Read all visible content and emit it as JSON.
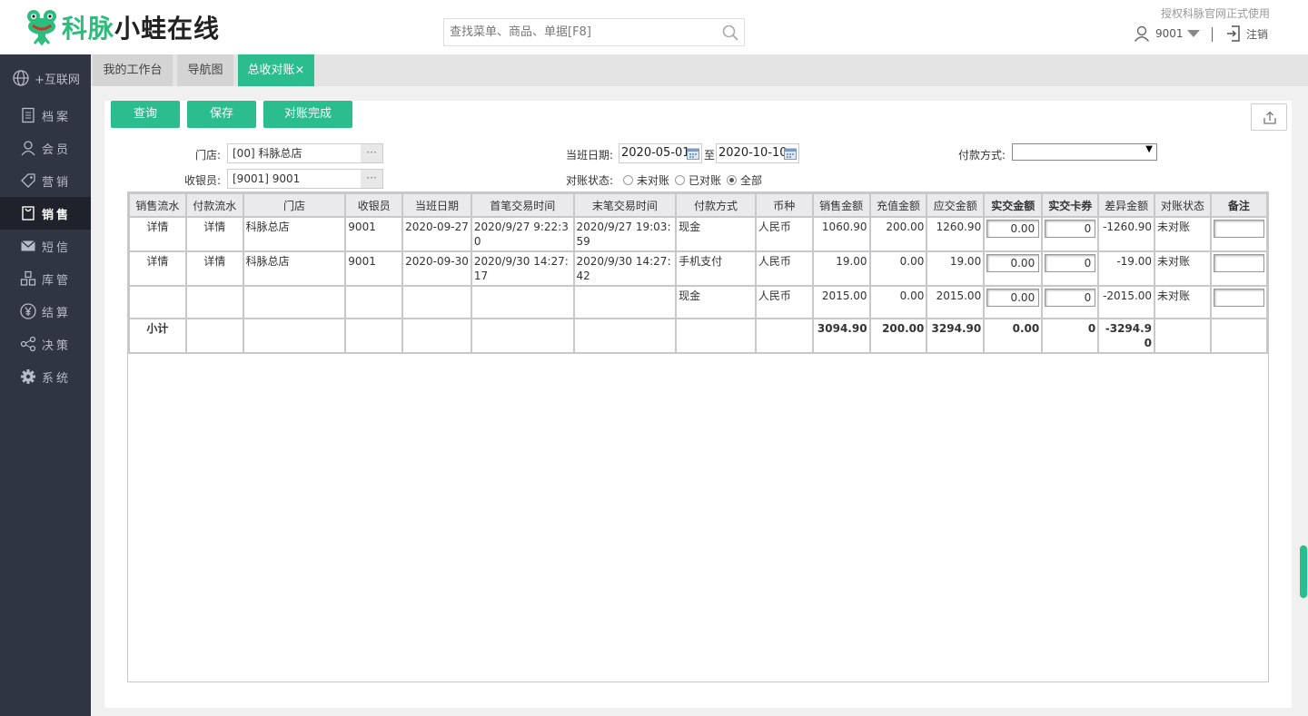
{
  "brand": {
    "part1": "科脉",
    "part2": "小蛙在线",
    "green": "#2bbd7e"
  },
  "search": {
    "placeholder": "查找菜单、商品、单据[F8]"
  },
  "header": {
    "auth_text": "授权科脉官网正式使用",
    "user": "9001",
    "logout": "注销"
  },
  "sidebar": {
    "items": [
      {
        "label": "+互联网",
        "icon": "globe-icon"
      },
      {
        "label": "档案",
        "icon": "document-icon"
      },
      {
        "label": "会员",
        "icon": "user-icon"
      },
      {
        "label": "营销",
        "icon": "tag-icon"
      },
      {
        "label": "销售",
        "icon": "bag-icon",
        "active": true
      },
      {
        "label": "短信",
        "icon": "mail-icon"
      },
      {
        "label": "库管",
        "icon": "boxes-icon"
      },
      {
        "label": "结算",
        "icon": "yen-icon"
      },
      {
        "label": "决策",
        "icon": "share-icon"
      },
      {
        "label": "系统",
        "icon": "gear-icon"
      }
    ]
  },
  "tabs": [
    {
      "label": "我的工作台"
    },
    {
      "label": "导航图"
    },
    {
      "label": "总收对账",
      "close": "×",
      "active": true
    }
  ],
  "toolbar": {
    "query": "查询",
    "save": "保存",
    "complete": "对账完成"
  },
  "form": {
    "store_label": "门店:",
    "store_value": "[00] 科脉总店",
    "cashier_label": "收银员:",
    "cashier_value": "[9001] 9001",
    "ellipsis": "···",
    "shift_date_label": "当班日期:",
    "date_from": "2020-05-01",
    "date_to_sep": "至",
    "date_to": "2020-10-10",
    "pay_method_label": "付款方式:",
    "pay_method_value": "",
    "status_label": "对账状态:",
    "status_options": [
      "未对账",
      "已对账",
      "全部"
    ],
    "status_selected": "全部"
  },
  "table": {
    "headers": [
      "销售流水",
      "付款流水",
      "门店",
      "收银员",
      "当班日期",
      "首笔交易时间",
      "末笔交易时间",
      "付款方式",
      "币种",
      "销售金额",
      "充值金额",
      "应交金额",
      "实交金额",
      "实交卡券",
      "差异金额",
      "对账状态",
      "备注"
    ],
    "rows": [
      {
        "sale_flow": "详情",
        "pay_flow": "详情",
        "store": "科脉总店",
        "cashier": "9001",
        "date": "2020-09-27",
        "first_time": "2020/9/27 9:22:30",
        "last_time": "2020/9/27 19:03:59",
        "pay_method": "现金",
        "currency": "人民币",
        "sales": "1060.90",
        "recharge": "200.00",
        "due": "1260.90",
        "paid": "0.00",
        "coupon": "0",
        "diff": "-1260.90",
        "status": "未对账",
        "remark": ""
      },
      {
        "sale_flow": "详情",
        "pay_flow": "详情",
        "store": "科脉总店",
        "cashier": "9001",
        "date": "2020-09-30",
        "first_time": "2020/9/30 14:27:17",
        "last_time": "2020/9/30 14:27:42",
        "pay_method": "手机支付",
        "currency": "人民币",
        "sales": "19.00",
        "recharge": "0.00",
        "due": "19.00",
        "paid": "0.00",
        "coupon": "0",
        "diff": "-19.00",
        "status": "未对账",
        "remark": ""
      },
      {
        "sale_flow": "",
        "pay_flow": "",
        "store": "",
        "cashier": "",
        "date": "",
        "first_time": "",
        "last_time": "",
        "pay_method": "现金",
        "currency": "人民币",
        "sales": "2015.00",
        "recharge": "0.00",
        "due": "2015.00",
        "paid": "0.00",
        "coupon": "0",
        "diff": "-2015.00",
        "status": "未对账",
        "remark": ""
      }
    ],
    "subtotal": {
      "label": "小计",
      "sales": "3094.90",
      "recharge": "200.00",
      "due": "3294.90",
      "paid": "0.00",
      "coupon": "0",
      "diff": "-3294.90"
    }
  }
}
